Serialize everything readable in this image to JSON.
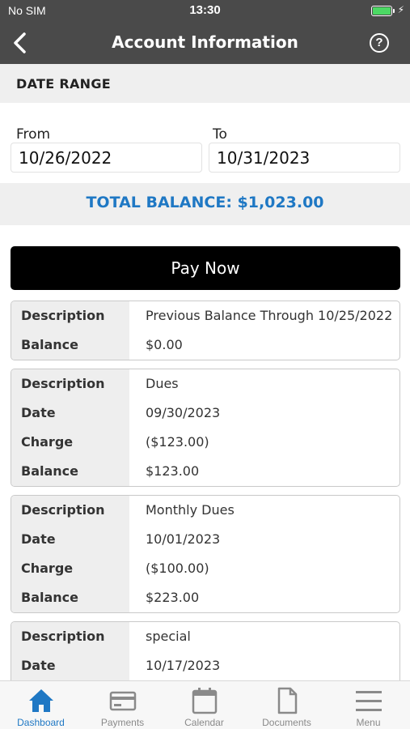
{
  "status_bar": {
    "carrier": "No SIM",
    "time": "13:30"
  },
  "nav": {
    "title": "Account Information"
  },
  "date_range": {
    "header": "DATE RANGE",
    "from_label": "From",
    "from_value": "10/26/2022",
    "to_label": "To",
    "to_value": "10/31/2023"
  },
  "total_balance": "TOTAL BALANCE: $1,023.00",
  "pay_now_label": "Pay Now",
  "transactions": [
    {
      "rows": [
        {
          "label": "Description",
          "value": "Previous Balance Through 10/25/2022"
        },
        {
          "label": "Balance",
          "value": "$0.00"
        }
      ]
    },
    {
      "rows": [
        {
          "label": "Description",
          "value": "Dues"
        },
        {
          "label": "Date",
          "value": "09/30/2023"
        },
        {
          "label": "Charge",
          "value": "($123.00)"
        },
        {
          "label": "Balance",
          "value": "$123.00"
        }
      ]
    },
    {
      "rows": [
        {
          "label": "Description",
          "value": "Monthly Dues"
        },
        {
          "label": "Date",
          "value": "10/01/2023"
        },
        {
          "label": "Charge",
          "value": "($100.00)"
        },
        {
          "label": "Balance",
          "value": "$223.00"
        }
      ]
    },
    {
      "rows": [
        {
          "label": "Description",
          "value": "special"
        },
        {
          "label": "Date",
          "value": "10/17/2023"
        }
      ]
    }
  ],
  "tabs": [
    {
      "label": "Dashboard",
      "icon": "home-icon",
      "active": true
    },
    {
      "label": "Payments",
      "icon": "credit-card-icon",
      "active": false
    },
    {
      "label": "Calendar",
      "icon": "calendar-icon",
      "active": false
    },
    {
      "label": "Documents",
      "icon": "document-icon",
      "active": false
    },
    {
      "label": "Menu",
      "icon": "menu-icon",
      "active": false
    }
  ],
  "colors": {
    "accent": "#1f78c4",
    "header_bg": "#4a4a4a",
    "battery": "#4cd964"
  }
}
